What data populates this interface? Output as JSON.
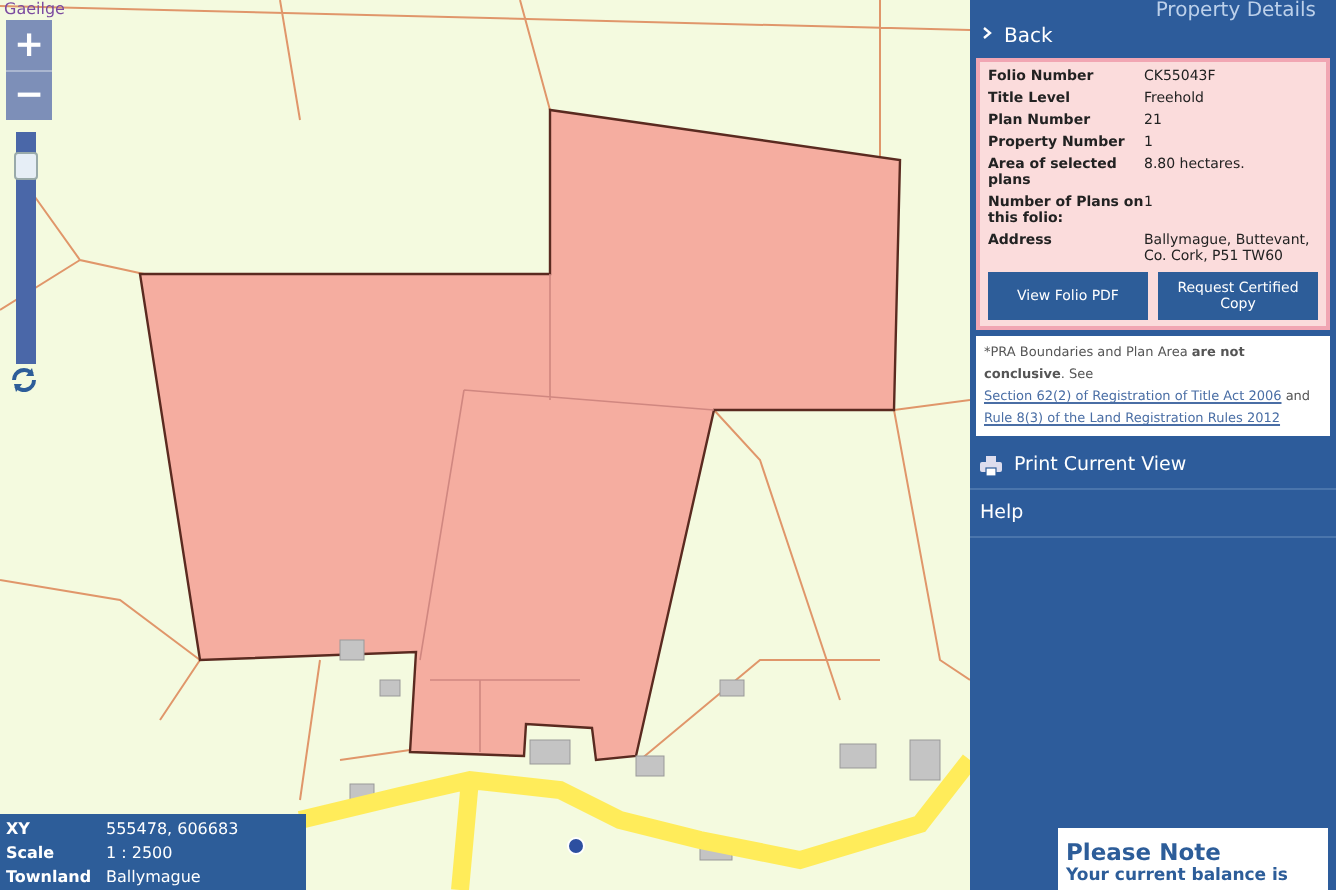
{
  "map": {
    "language_link": "Gaeilge",
    "zoom_in": "+",
    "zoom_out": "−",
    "zoom_slider": {
      "level": 0.9
    },
    "info": [
      {
        "label": "XY",
        "value": "555478, 606683"
      },
      {
        "label": "Scale",
        "value": "1 : 2500"
      },
      {
        "label": "Townland",
        "value": "Ballymague"
      }
    ]
  },
  "sidebar": {
    "title": "Property Details",
    "back": "Back",
    "details": [
      {
        "label": "Folio Number",
        "value": "CK55043F"
      },
      {
        "label": "Title Level",
        "value": "Freehold"
      },
      {
        "label": "Plan Number",
        "value": "21"
      },
      {
        "label": "Property Number",
        "value": "1"
      },
      {
        "label": "Area of selected plans",
        "value": "8.80 hectares."
      },
      {
        "label": "Number of Plans on this folio:",
        "value": "1"
      },
      {
        "label": "Address",
        "value": "Ballymague, Buttevant, Co. Cork, P51 TW60"
      }
    ],
    "buttons": [
      "View Folio PDF",
      "Request Certified Copy"
    ],
    "notice": {
      "text": "*PRA Boundaries and Plan Area **are not conclusive**. See",
      "link1": "Section 62(2) of Registration of Title Act 2006",
      "middle": "and",
      "link2": "Rule 8(3) of the Land Registration Rules 2012"
    },
    "menu": [
      "Print Current View",
      "Help"
    ],
    "note": {
      "title": "Please Note",
      "text": "Your current balance is"
    }
  }
}
